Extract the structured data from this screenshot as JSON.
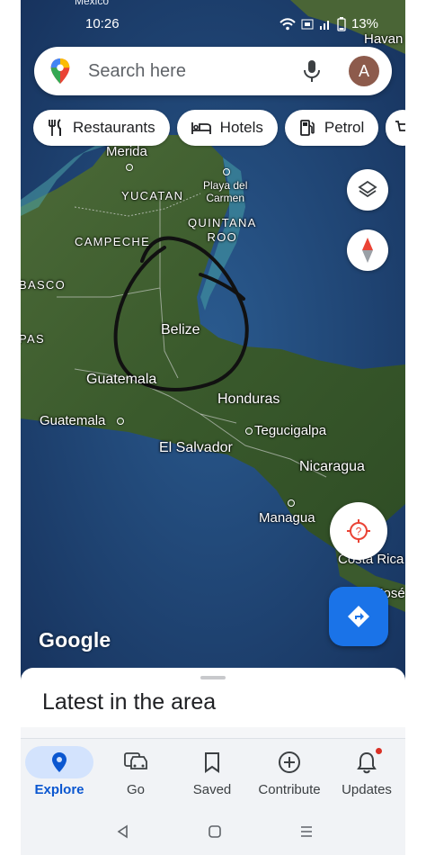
{
  "status_bar": {
    "top_label": "Mexico",
    "time": "10:26",
    "battery": "13%"
  },
  "search": {
    "placeholder": "Search here",
    "avatar_letter": "A"
  },
  "chips": [
    {
      "label": "Restaurants",
      "icon": "fork-knife-icon"
    },
    {
      "label": "Hotels",
      "icon": "bed-icon"
    },
    {
      "label": "Petrol",
      "icon": "fuel-pump-icon"
    }
  ],
  "map": {
    "labels": {
      "havana": "Havan",
      "merida": "Merida",
      "yucatan": "YUCATAN",
      "playa_del_carmen": "Playa del\nCarmen",
      "quintana_roo": "QUINTANA\nROO",
      "campeche": "CAMPECHE",
      "tabasco": "BASCO",
      "chiapas": "PAS",
      "belize": "Belize",
      "guatemala_country": "Guatemala",
      "guatemala_city": "Guatemala",
      "honduras": "Honduras",
      "tegucigalpa": "Tegucigalpa",
      "el_salvador": "El Salvador",
      "nicaragua": "Nicaragua",
      "managua": "Managua",
      "costa_rica": "Costa Rica",
      "san_jose": "José"
    },
    "attribution": "Google",
    "annotation": "hand-drawn circle around Belize"
  },
  "sheet": {
    "title": "Latest in the area"
  },
  "bottom_nav": [
    {
      "label": "Explore",
      "icon": "location-pin-icon",
      "active": true
    },
    {
      "label": "Go",
      "icon": "car-icon",
      "active": false
    },
    {
      "label": "Saved",
      "icon": "bookmark-icon",
      "active": false
    },
    {
      "label": "Contribute",
      "icon": "add-circle-icon",
      "active": false
    },
    {
      "label": "Updates",
      "icon": "bell-icon",
      "active": false
    }
  ],
  "colors": {
    "accent": "#1a73e8",
    "nav_active_bg": "#d3e3fd",
    "nav_active_text": "#0b57d0",
    "notification_dot": "#d93025"
  }
}
